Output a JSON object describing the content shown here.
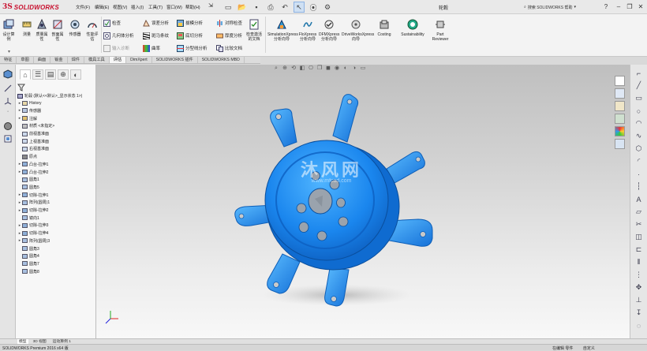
{
  "app": {
    "logo_ds": "3S",
    "logo_text": "SOLIDWORKS",
    "document_title": "轮毂"
  },
  "menu": [
    "文件(F)",
    "编辑(E)",
    "视图(V)",
    "插入(I)",
    "工具(T)",
    "窗口(W)",
    "帮助(H)"
  ],
  "search": {
    "placeholder": "搜索 SOLIDWORKS 帮助"
  },
  "ribbon": {
    "big": [
      "设计算例",
      "测量",
      "质量属性",
      "剖面属性",
      "传感器",
      "性能评估"
    ],
    "rows": [
      "检查",
      "几何体分析",
      "输入诊断",
      "误差分析",
      "斑马条纹",
      "曲率",
      "拔模分析",
      "底切分析",
      "分型线分析",
      "对称检查",
      "厚度分析",
      "比较文档",
      "检查激活的文档"
    ],
    "products": [
      "SimulationXpress分析向导",
      "FloXpress分析向导",
      "DFMXpress分析向导",
      "DriveWorksXpress向导",
      "Costing",
      "Sustainability",
      "Part Reviewer"
    ]
  },
  "tabs": [
    "特征",
    "草图",
    "曲面",
    "钣金",
    "焊件",
    "模具工具",
    "评估",
    "DimXpert",
    "SOLIDWORKS 插件",
    "SOLIDWORKS MBD"
  ],
  "tree": {
    "root": "轮毂 (默认<<默认>_显示状态 1>)",
    "items": [
      "History",
      "传感器",
      "注解",
      "材质 <未指定>",
      "前视基准面",
      "上视基准面",
      "右视基准面",
      "原点",
      "凸台-拉伸1",
      "凸台-拉伸2",
      "圆角1",
      "圆角5",
      "切除-拉伸1",
      "阵列(圆周)1",
      "切除-拉伸2",
      "镜向1",
      "切除-拉伸3",
      "切除-拉伸4",
      "阵列(圆周)3",
      "圆角3",
      "圆角4",
      "圆角7",
      "圆角8"
    ]
  },
  "viewport": {
    "watermark": "沐风网",
    "watermark_url": "www.mfcad.com"
  },
  "bottom_tabs": [
    "模型",
    "3D 视图",
    "运动算例 1"
  ],
  "status": {
    "left": "SOLIDWORKS Premium 2016 x64 版",
    "right_1": "在编辑 零件",
    "right_2": "自定义"
  },
  "colors": {
    "part": "#1a7fe6",
    "brand": "#c8102e"
  }
}
